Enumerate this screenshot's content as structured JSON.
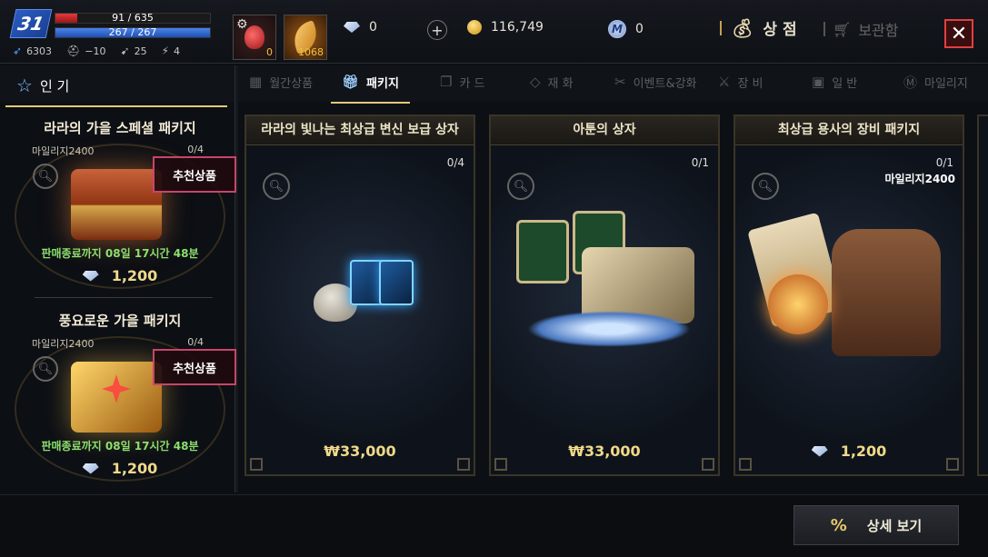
{
  "player": {
    "level": "31",
    "hp": "91 / 635",
    "mp": "267 / 267",
    "stats": [
      "6303",
      "−10",
      "25",
      "4"
    ]
  },
  "slots": [
    {
      "count": "0",
      "icon": "potion-icon"
    },
    {
      "count": "1068",
      "icon": "wing-icon"
    }
  ],
  "currency": {
    "diamond": "0",
    "gold": "116,749",
    "mileage": "0",
    "mileage_symbol": "M"
  },
  "header": {
    "shop_label": "상 점",
    "storage_label": "보관함"
  },
  "tabs": [
    {
      "label": "인 기"
    },
    {
      "label": "월간상품"
    },
    {
      "label": "패키지"
    },
    {
      "label": "카 드"
    },
    {
      "label": "재 화"
    },
    {
      "label": "이벤트&강화"
    },
    {
      "label": "장 비"
    },
    {
      "label": "일 반"
    },
    {
      "label": "마일리지"
    }
  ],
  "side_items": [
    {
      "title": "라라의 가을 스페셜 패키지",
      "mileage": "마일리지2400",
      "count": "0/4",
      "badge": "추천상품",
      "timer": "판매종료까지 08일 17시간 48분",
      "price": "1,200"
    },
    {
      "title": "풍요로운 가을 패키지",
      "mileage": "마일리지2400",
      "count": "0/4",
      "badge": "추천상품",
      "timer": "판매종료까지 08일 17시간 48분",
      "price": "1,200"
    }
  ],
  "cards": [
    {
      "title": "라라의 빛나는 최상급 변신 보급 상자",
      "count": "0/4",
      "price": "₩33,000"
    },
    {
      "title": "아툰의 상자",
      "count": "0/1",
      "price": "₩33,000"
    },
    {
      "title": "최상급 용사의 장비 패키지",
      "count": "0/1",
      "mileage": "마일리지2400",
      "price": "1,200"
    }
  ],
  "footer": {
    "detail_label": "상세 보기",
    "detail_icon": "%"
  },
  "colors": {
    "accent_gold": "#e6c877",
    "price_gold": "#f0d98a",
    "timer_green": "#8ce06e",
    "badge_border": "#c9456a",
    "close_red": "#e04040"
  }
}
